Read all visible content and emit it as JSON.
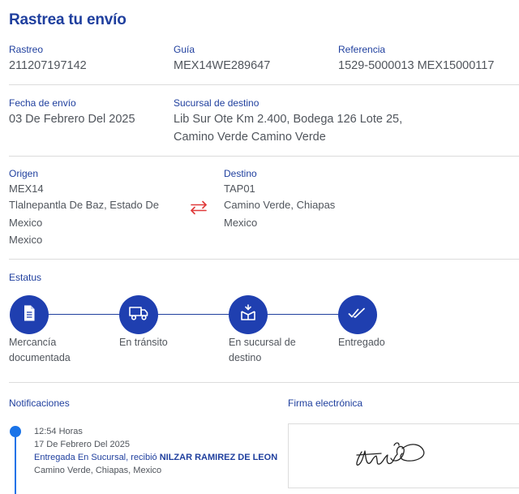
{
  "header": {
    "title": "Rastrea tu envío"
  },
  "row1": {
    "tracking_label": "Rastreo",
    "tracking_value": "211207197142",
    "guide_label": "Guía",
    "guide_value": "MEX14WE289647",
    "reference_label": "Referencia",
    "reference_value": "1529-5000013 MEX15000117"
  },
  "row2": {
    "ship_date_label": "Fecha de envío",
    "ship_date_value": "03 De Febrero Del 2025",
    "branch_label": "Sucursal de destino",
    "branch_line1": "Lib Sur Ote Km 2.400, Bodega 126 Lote 25,",
    "branch_line2": "Camino Verde Camino Verde"
  },
  "origin": {
    "label": "Origen",
    "code": "MEX14",
    "line1": "Tlalnepantla De Baz, Estado De",
    "line2": "Mexico",
    "line3": "Mexico"
  },
  "destination": {
    "label": "Destino",
    "code": "TAP01",
    "line1": "Camino Verde, Chiapas",
    "line2": "Mexico"
  },
  "status": {
    "label": "Estatus",
    "steps": [
      {
        "line1": "Mercancía",
        "line2": "documentada",
        "icon": "document-icon"
      },
      {
        "line1": "En tránsito",
        "line2": "",
        "icon": "truck-icon"
      },
      {
        "line1": "En sucursal de",
        "line2": "destino",
        "icon": "box-icon"
      },
      {
        "line1": "Entregado",
        "line2": "",
        "icon": "double-check-icon"
      }
    ]
  },
  "notifications": {
    "label": "Notificaciones",
    "items": [
      {
        "time": "12:54 Horas",
        "date": "17 De Febrero Del 2025",
        "status_prefix": "Entregada En Sucursal, recibió ",
        "receiver": "NILZAR RAMIREZ DE LEON",
        "location": "Camino Verde, Chiapas, Mexico"
      }
    ]
  },
  "signature": {
    "label": "Firma electrónica"
  },
  "colors": {
    "primary": "#1f3fb0",
    "heading": "#1f3f9e",
    "timeline": "#1a73e8",
    "swap_arrows": "#e03a3a"
  }
}
